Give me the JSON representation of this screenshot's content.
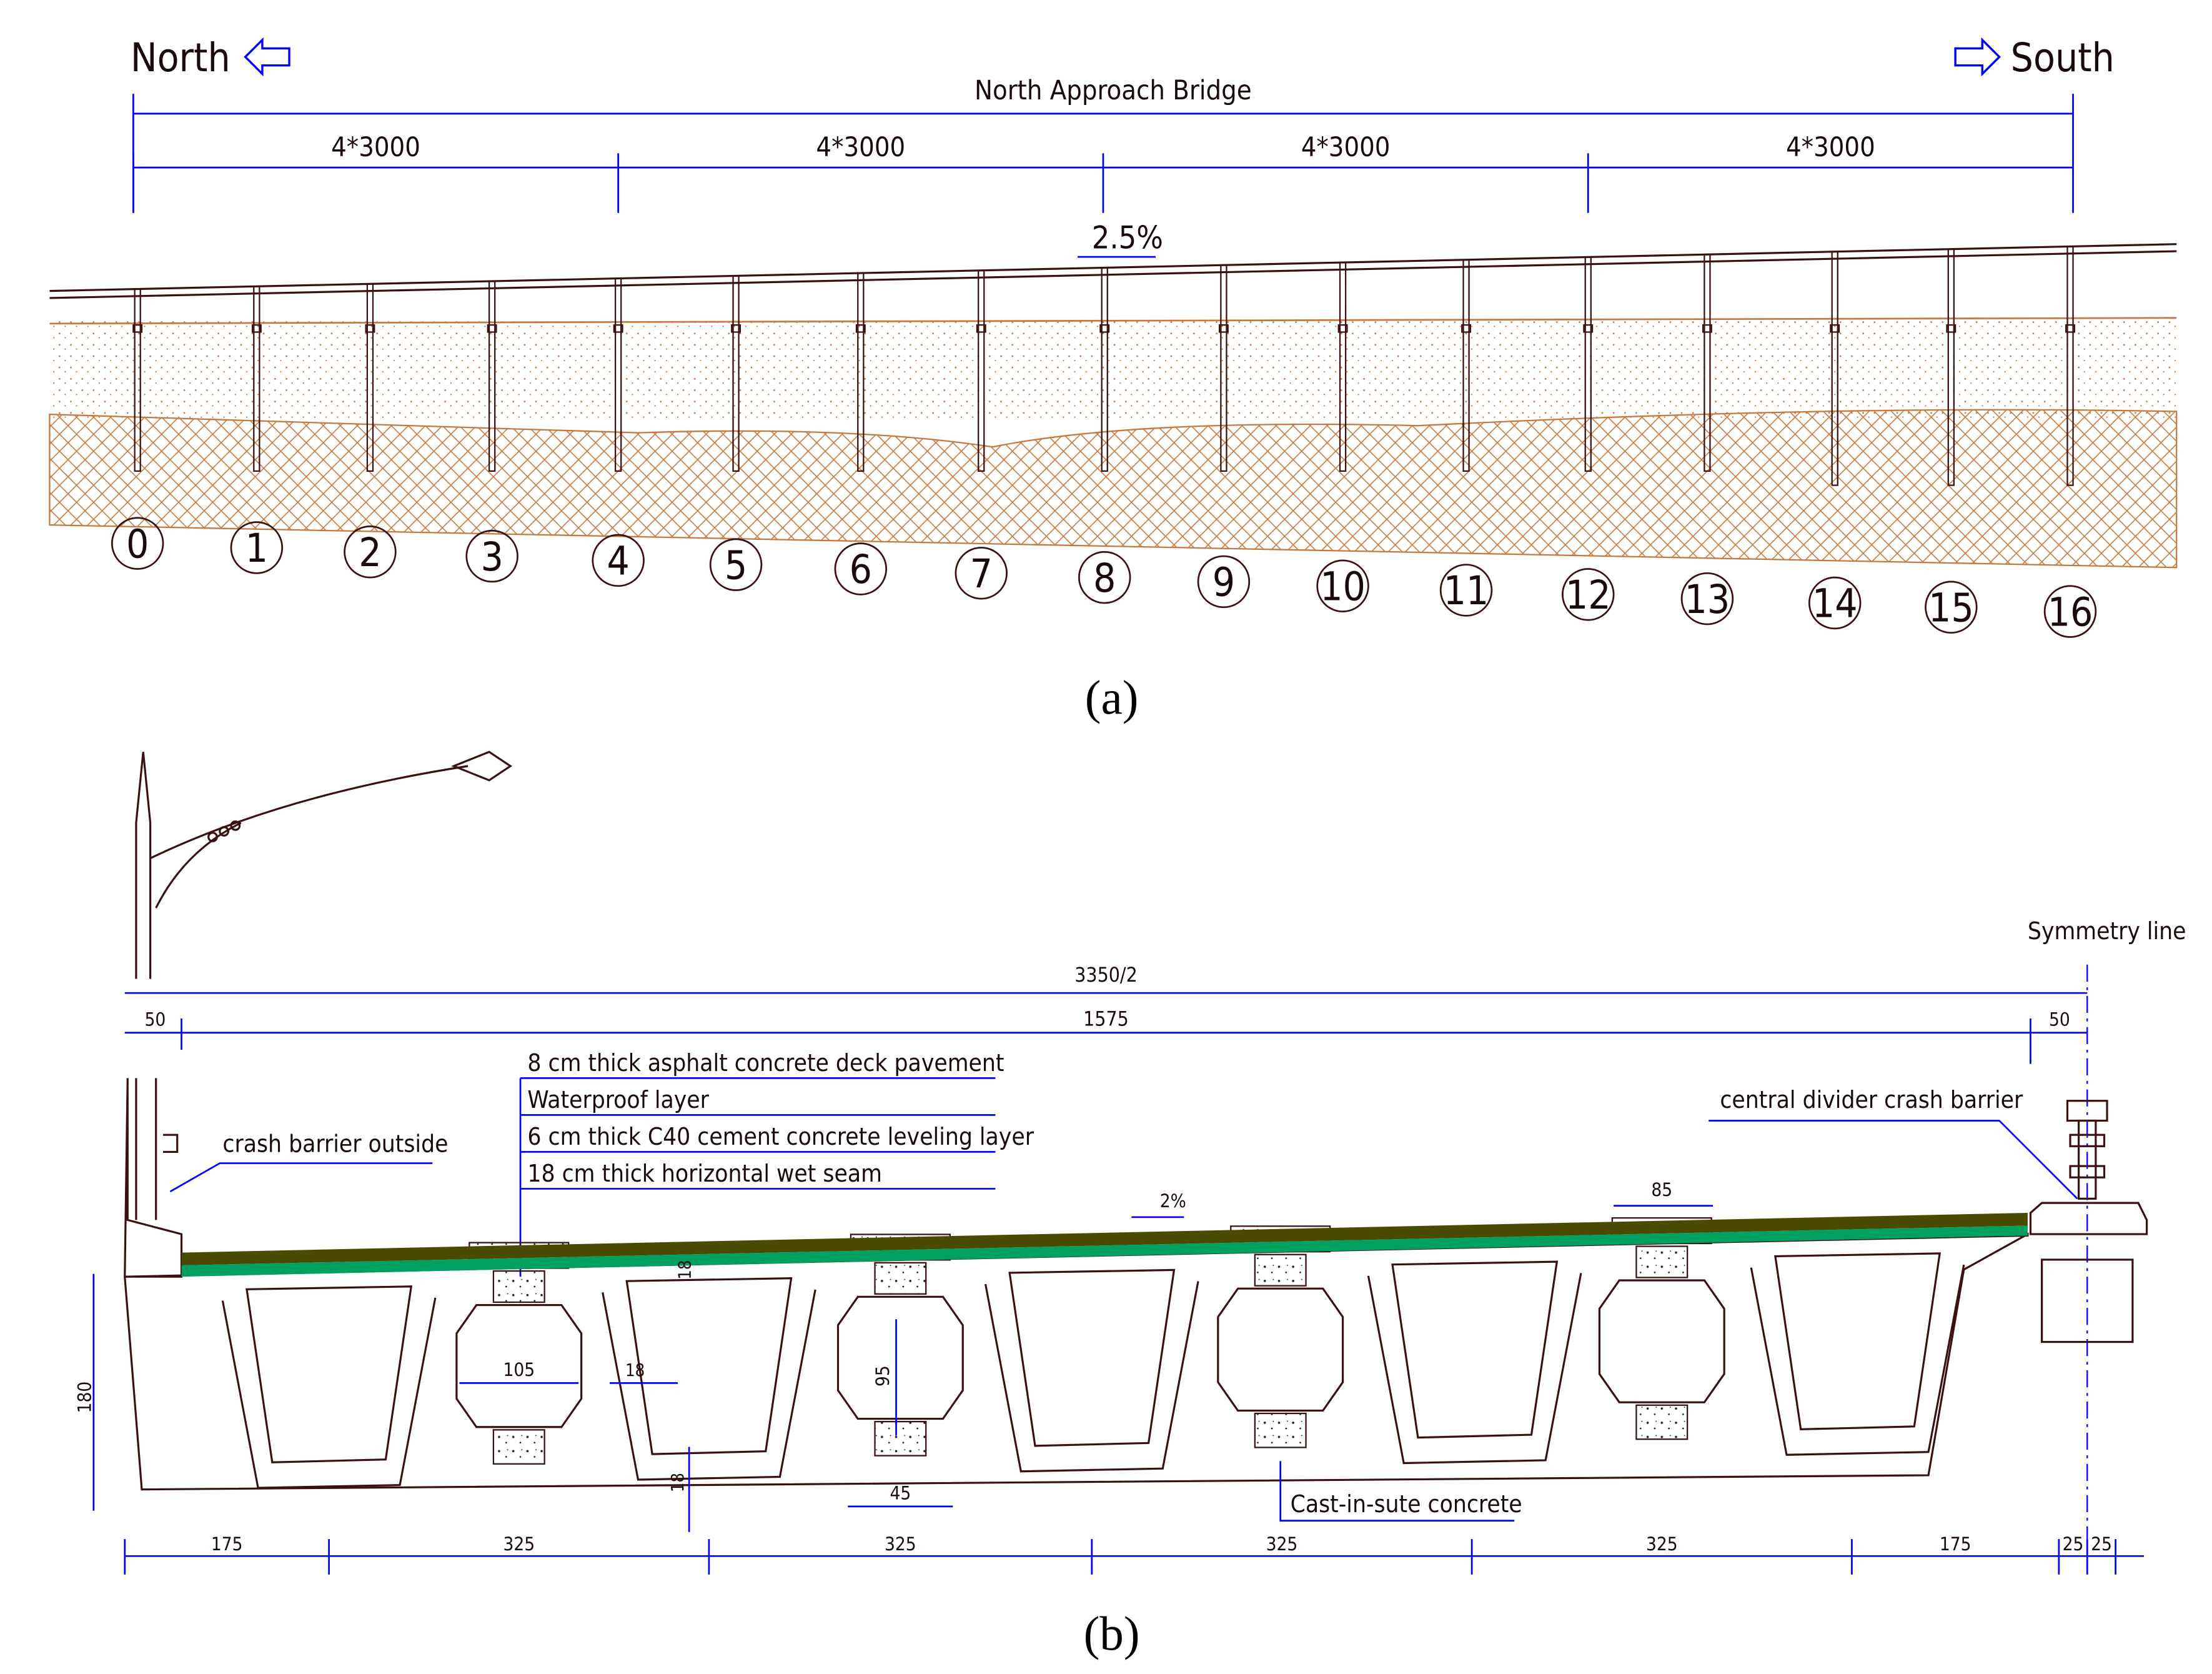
{
  "part_a": {
    "north_label": "North",
    "south_label": "South",
    "bridge_title": "North Approach Bridge",
    "span_labels": [
      "4*3000",
      "4*3000",
      "4*3000",
      "4*3000"
    ],
    "slope_label": "2.5%",
    "pier_numbers": [
      "0",
      "1",
      "2",
      "3",
      "4",
      "5",
      "6",
      "7",
      "8",
      "9",
      "10",
      "11",
      "12",
      "13",
      "14",
      "15",
      "16"
    ],
    "caption": "(a)"
  },
  "part_b": {
    "symmetry_label": "Symmetry line",
    "total_width_label": "3350/2",
    "left_edge_label": "50",
    "main_width_label": "1575",
    "right_edge_label": "50",
    "layers": [
      "8 cm thick asphalt concrete deck pavement",
      "Waterproof layer",
      "6 cm thick C40 cement concrete leveling layer",
      "18 cm thick horizontal wet seam"
    ],
    "crash_barrier_outside": "crash barrier outside",
    "central_barrier": "central divider crash barrier",
    "slope_label": "2%",
    "hinge_width_label": "85",
    "height_label": "180",
    "slab_label": "18",
    "web_label": "18",
    "bottom_label": "18",
    "void_width_label": "105",
    "void_height_label": "95",
    "joint_width_label": "45",
    "cast_label": "Cast-in-sute concrete",
    "bottom_dims": [
      "175",
      "325",
      "325",
      "325",
      "325",
      "175",
      "25",
      "25"
    ],
    "caption": "(b)",
    "colors": {
      "asphalt": "#4a4a00",
      "leveling": "#00a060",
      "dim": "#0000ff"
    }
  }
}
